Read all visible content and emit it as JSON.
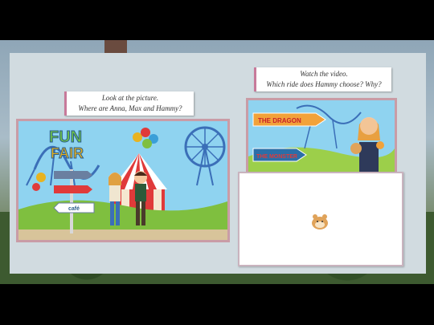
{
  "left": {
    "caption_line1": "Look at the picture.",
    "caption_line2": "Where are Anna, Max and Hammy?",
    "logo_line1": "FUN",
    "logo_line2": "FAIR",
    "signs": [
      "",
      "",
      "café"
    ]
  },
  "right": {
    "caption_line1": "Watch the video.",
    "caption_line2": "Which ride does Hammy choose? Why?",
    "sign_top": "THE DRAGON",
    "sign_bottom": "THE MONSTER"
  },
  "colors": {
    "frame": "#c99ca6",
    "caption_accent": "#c77a9a",
    "sky": "#8fd3f0",
    "grass": "#7fbf3f"
  }
}
